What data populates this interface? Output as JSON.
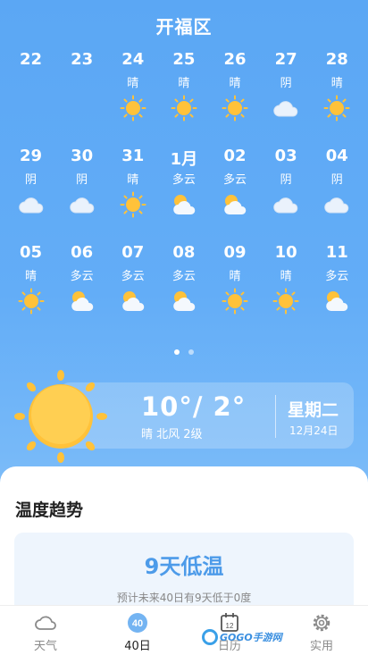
{
  "header": {
    "title": "开福区"
  },
  "calendar": [
    [
      {
        "day": "22",
        "cond": "",
        "icon": ""
      },
      {
        "day": "23",
        "cond": "",
        "icon": ""
      },
      {
        "day": "24",
        "cond": "晴",
        "icon": "sun-icon"
      },
      {
        "day": "25",
        "cond": "晴",
        "icon": "sun-icon"
      },
      {
        "day": "26",
        "cond": "晴",
        "icon": "sun-icon"
      },
      {
        "day": "27",
        "cond": "阴",
        "icon": "cloud-icon"
      },
      {
        "day": "28",
        "cond": "晴",
        "icon": "sun-icon"
      }
    ],
    [
      {
        "day": "29",
        "cond": "阴",
        "icon": "cloud-icon"
      },
      {
        "day": "30",
        "cond": "阴",
        "icon": "cloud-icon"
      },
      {
        "day": "31",
        "cond": "晴",
        "icon": "sun-icon"
      },
      {
        "day": "1月",
        "cond": "多云",
        "icon": "partly-cloudy-icon"
      },
      {
        "day": "02",
        "cond": "多云",
        "icon": "partly-cloudy-icon"
      },
      {
        "day": "03",
        "cond": "阴",
        "icon": "cloud-icon"
      },
      {
        "day": "04",
        "cond": "阴",
        "icon": "cloud-icon"
      }
    ],
    [
      {
        "day": "05",
        "cond": "晴",
        "icon": "sun-icon"
      },
      {
        "day": "06",
        "cond": "多云",
        "icon": "partly-cloudy-icon"
      },
      {
        "day": "07",
        "cond": "多云",
        "icon": "partly-cloudy-icon"
      },
      {
        "day": "08",
        "cond": "多云",
        "icon": "partly-cloudy-icon"
      },
      {
        "day": "09",
        "cond": "晴",
        "icon": "sun-icon"
      },
      {
        "day": "10",
        "cond": "晴",
        "icon": "sun-icon"
      },
      {
        "day": "11",
        "cond": "多云",
        "icon": "partly-cloudy-icon"
      }
    ]
  ],
  "pager": {
    "count": 2,
    "active": 0
  },
  "today": {
    "temp": "10°/ 2°",
    "desc": "晴  北风  2级",
    "weekday": "星期二",
    "date": "12月24日"
  },
  "trend": {
    "title": "温度趋势",
    "headline": "9天低温",
    "subtitle": "预计未来40日有9天低于0度"
  },
  "nav": [
    {
      "label": "天气",
      "icon": "cloud-outline-icon",
      "active": false
    },
    {
      "label": "40日",
      "icon": "forty-day-icon",
      "active": true
    },
    {
      "label": "日历",
      "icon": "calendar-icon",
      "active": false
    },
    {
      "label": "实用",
      "icon": "gear-icon",
      "active": false
    }
  ],
  "calendar_icon_day": "12",
  "forty_badge": "40",
  "watermark": "GOGO手游网",
  "colors": {
    "accent": "#4d9be9",
    "background": "#5ba7f4",
    "sun": "#ffc23a"
  }
}
